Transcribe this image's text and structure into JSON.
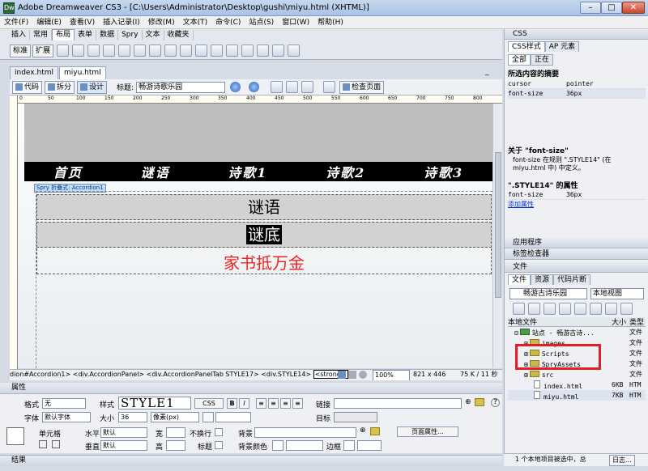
{
  "window": {
    "title": "Adobe Dreamweaver CS3 - [C:\\Users\\Administrator\\Desktop\\gushi\\miyu.html (XHTML)]"
  },
  "menu": [
    "文件(F)",
    "编辑(E)",
    "查看(V)",
    "插入记录(I)",
    "修改(M)",
    "文本(T)",
    "命令(C)",
    "站点(S)",
    "窗口(W)",
    "帮助(H)"
  ],
  "insert_bar": {
    "tabs": [
      "插入",
      "常用",
      "布局",
      "表单",
      "数据",
      "Spry",
      "文本",
      "收藏夹"
    ],
    "active_tab": "布局",
    "standard_btn": "标准",
    "expand_btn": "扩展"
  },
  "doc_tabs": [
    "index.html",
    "miyu.html"
  ],
  "doc_toolbar": {
    "code_btn": "代码",
    "split_btn": "拆分",
    "design_btn": "设计",
    "title_label": "标题:",
    "title_value": "畅游诗歌乐园",
    "check_page": "检查页面"
  },
  "ruler_ticks": [
    "0",
    "50",
    "100",
    "150",
    "200",
    "250",
    "300",
    "350",
    "400",
    "450",
    "500",
    "550",
    "600",
    "650",
    "700",
    "750",
    "800"
  ],
  "page": {
    "nav": [
      "首页",
      "谜语",
      "诗歌1",
      "诗歌2",
      "诗歌3"
    ],
    "spry_label": "Spry 折叠式: Accordion1",
    "panel1_tab": "谜语",
    "panel2_tab": "谜底",
    "answer": "家书抵万金"
  },
  "tag_selector": {
    "path": "dion#Accordion1> <div.AccordionPanel> <div.AccordionPanelTab STYLE17> <div.STYLE14>",
    "strong": "<strong>",
    "zoom": "100%",
    "size": "821 x 446",
    "file_size": "75 K / 11 秒"
  },
  "properties": {
    "header": "属性",
    "format_label": "格式",
    "format_value": "无",
    "style_label": "样式",
    "style_value": "STYLE1",
    "css_btn": "CSS",
    "link_label": "链接",
    "font_label": "字体",
    "font_value": "默认字体",
    "size_label": "大小",
    "size_value": "36",
    "unit_value": "像素(px)",
    "target_label": "目标",
    "cell_label": "单元格",
    "horiz_label": "水平",
    "horiz_value": "默认",
    "width_label": "宽",
    "nowrap_label": "不换行",
    "bg_label": "背景",
    "page_props_btn": "页面属性...",
    "vert_label": "垂直",
    "vert_value": "默认",
    "height_label": "高",
    "header_label": "标题",
    "bgcolor_label": "背景颜色",
    "border_label": "边框"
  },
  "results_bar": "结果",
  "css_panel": {
    "header": "CSS",
    "tabs": [
      "CSS样式",
      "AP 元素"
    ],
    "mode_btns": [
      "全部",
      "正在"
    ],
    "summary_title": "所选内容的摘要",
    "summary_rows": [
      {
        "prop": "cursor",
        "val": "pointer"
      },
      {
        "prop": "font-size",
        "val": "36px"
      }
    ],
    "about_title": "关于 \"font-size\"",
    "about_text": "font-size 在规则 \".STYLE14\" (在 miyu.html 中) 中定义。",
    "rule_title": "\".STYLE14\" 的属性",
    "rule_rows": [
      {
        "prop": "font-size",
        "val": "36px"
      }
    ],
    "add_prop": "添加属性"
  },
  "app_panel": "应用程序",
  "tag_inspector_panel": "标签检查器",
  "files_panel": {
    "header": "文件",
    "tabs": [
      "文件",
      "资源",
      "代码片断"
    ],
    "site": "畅游古诗乐园",
    "view": "本地视图",
    "columns": [
      "本地文件",
      "大小",
      "类型"
    ],
    "tree": [
      {
        "name": "站点 - 畅游古诗...",
        "size": "",
        "type": "文件",
        "kind": "root"
      },
      {
        "name": "images",
        "size": "",
        "type": "文件",
        "kind": "folder"
      },
      {
        "name": "Scripts",
        "size": "",
        "type": "文件",
        "kind": "folder"
      },
      {
        "name": "SpryAssets",
        "size": "",
        "type": "文件",
        "kind": "folder"
      },
      {
        "name": "src",
        "size": "",
        "type": "文件",
        "kind": "folder"
      },
      {
        "name": "index.html",
        "size": "6KB",
        "type": "HTM",
        "kind": "file"
      },
      {
        "name": "miyu.html",
        "size": "7KB",
        "type": "HTM",
        "kind": "file"
      }
    ],
    "status": "1 个本地项目被选中，总",
    "log_btn": "日志..."
  },
  "colors": {
    "highlight_box": "#e51c23",
    "answer_text": "#e22222",
    "nav_bg": "#000000"
  }
}
